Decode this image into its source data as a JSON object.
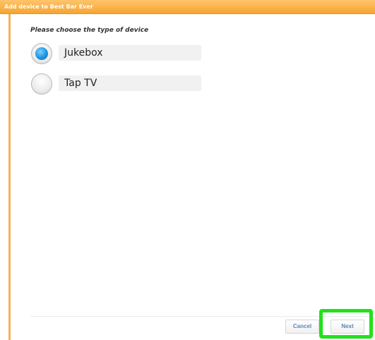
{
  "dialog": {
    "title": "Add device to Best Bar Ever",
    "prompt": "Please choose the type of device",
    "options": [
      {
        "label": "Jukebox",
        "selected": true
      },
      {
        "label": "Tap TV",
        "selected": false
      }
    ],
    "buttons": {
      "cancel": "Cancel",
      "next": "Next"
    }
  },
  "colors": {
    "titlebar": "#f7a431",
    "radio_selected": "#1e94dd",
    "highlight": "#22e11c"
  }
}
